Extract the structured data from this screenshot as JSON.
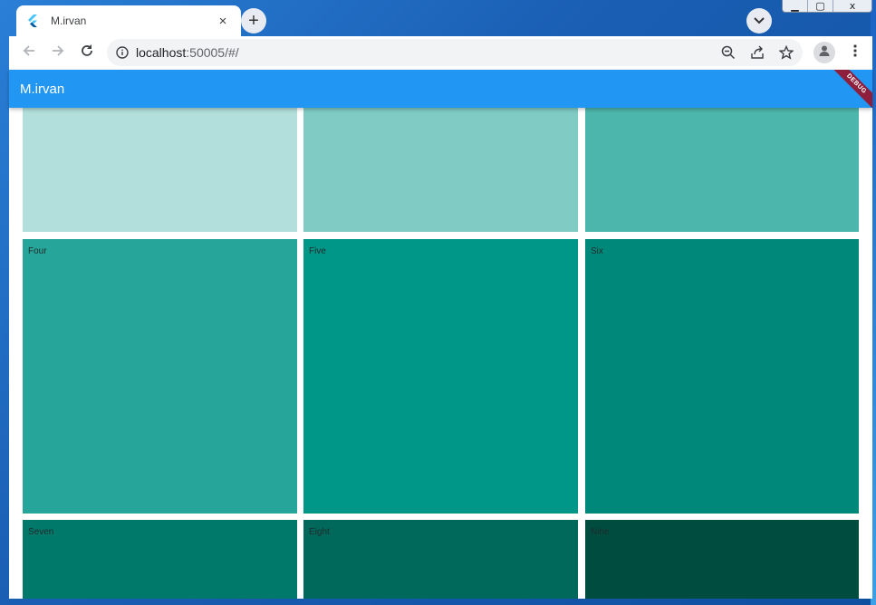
{
  "window": {
    "controls": {
      "minimize": "▁",
      "maximize": "▢",
      "close": "x"
    }
  },
  "browser": {
    "tab": {
      "title": "M.irvan",
      "favicon": "flutter-icon",
      "close": "×"
    },
    "new_tab": "+",
    "address": {
      "host": "localhost",
      "path": ":50005/#/"
    },
    "icons": [
      "back-icon",
      "forward-icon",
      "reload-icon",
      "info-icon",
      "zoom-out-icon",
      "share-icon",
      "star-icon",
      "profile-icon",
      "menu-icon"
    ]
  },
  "app": {
    "title": "M.irvan",
    "debug_banner": "DEBUG",
    "primary_color": "#2196f3",
    "tiles": [
      {
        "label": "",
        "color": "#b2dfdb"
      },
      {
        "label": "",
        "color": "#80cbc4"
      },
      {
        "label": "",
        "color": "#4db6ac"
      },
      {
        "label": "Four",
        "color": "#26a69a"
      },
      {
        "label": "Five",
        "color": "#009688"
      },
      {
        "label": "Six",
        "color": "#00897b"
      },
      {
        "label": "Seven",
        "color": "#00796b"
      },
      {
        "label": "Eight",
        "color": "#00695c"
      },
      {
        "label": "Nine",
        "color": "#004d40"
      }
    ]
  }
}
